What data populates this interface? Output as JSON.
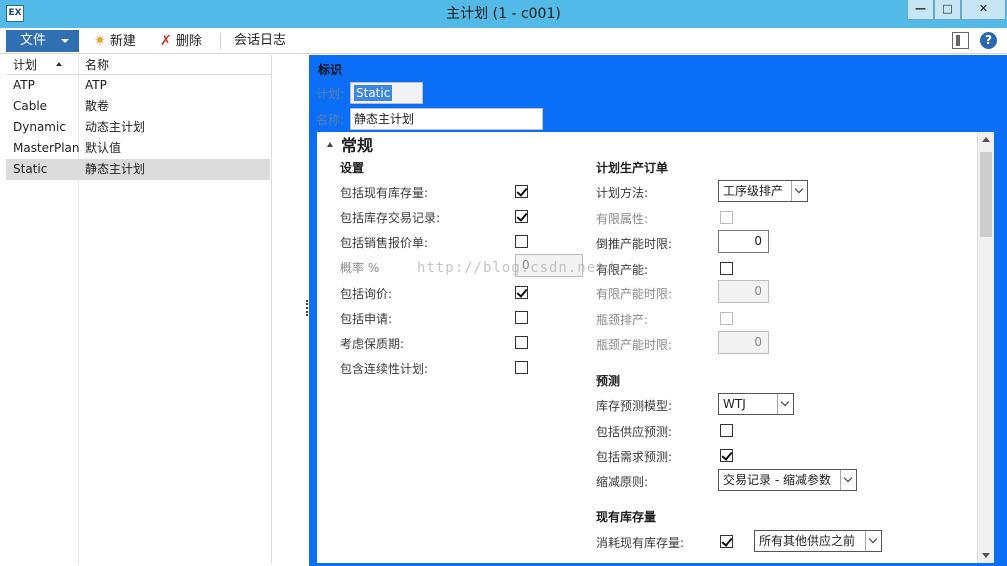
{
  "window": {
    "app_icon_text": "EX",
    "title": "主计划 (1 - c001)",
    "minimize_label": "—",
    "maximize_label": "□",
    "close_label": "✕"
  },
  "toolbar": {
    "file_label": "文件",
    "new_label": "新建",
    "delete_label": "删除",
    "session_log_label": "会话日志",
    "help_label": "?"
  },
  "list": {
    "col_plan": "计划",
    "col_name": "名称",
    "rows": [
      {
        "plan": "ATP",
        "name": "ATP"
      },
      {
        "plan": "Cable",
        "name": "散卷"
      },
      {
        "plan": "Dynamic",
        "name": "动态主计划"
      },
      {
        "plan": "MasterPlan",
        "name": "默认值"
      },
      {
        "plan": "Static",
        "name": "静态主计划"
      }
    ],
    "selected_index": 4
  },
  "identification": {
    "section_title": "标识",
    "plan_label": "计划:",
    "plan_value": "Static",
    "name_label": "名称:",
    "name_value": "静态主计划"
  },
  "general": {
    "title": "常规",
    "settings": {
      "title": "设置",
      "include_onhand_label": "包括现有库存量:",
      "include_onhand": true,
      "include_inv_trans_label": "包括库存交易记录:",
      "include_inv_trans": true,
      "include_sales_quote_label": "包括销售报价单:",
      "include_sales_quote": false,
      "probability_label": "概率 %",
      "probability_value": "0",
      "include_rfq_label": "包括询价:",
      "include_rfq": true,
      "include_requisition_label": "包括申请:",
      "include_requisition": false,
      "shelf_life_label": "考虑保质期:",
      "shelf_life": false,
      "continuity_label": "包含连续性计划:",
      "continuity": false
    },
    "planned_production": {
      "title": "计划生产订单",
      "method_label": "计划方法:",
      "method_value": "工序级排产",
      "finite_property_label": "有限属性:",
      "finite_property": false,
      "backward_label": "倒推产能时限:",
      "backward_value": "0",
      "finite_capacity_label": "有限产能:",
      "finite_capacity": false,
      "finite_capacity_time_label": "有限产能时限:",
      "finite_capacity_time_value": "0",
      "bottleneck_label": "瓶颈排产:",
      "bottleneck": false,
      "bottleneck_time_label": "瓶颈产能时限:",
      "bottleneck_time_value": "0"
    },
    "forecast": {
      "title": "预测",
      "model_label": "库存预测模型:",
      "model_value": "WTJ",
      "include_supply_label": "包括供应预测:",
      "include_supply": false,
      "include_demand_label": "包括需求预测:",
      "include_demand": true,
      "reduction_label": "缩减原则:",
      "reduction_value": "交易记录 - 缩减参数"
    },
    "onhand": {
      "title": "现有库存量",
      "consume_label": "消耗现有库存量:",
      "consume": true,
      "consume_option": "所有其他供应之前"
    }
  },
  "watermark": "http://blog.csdn.net/"
}
